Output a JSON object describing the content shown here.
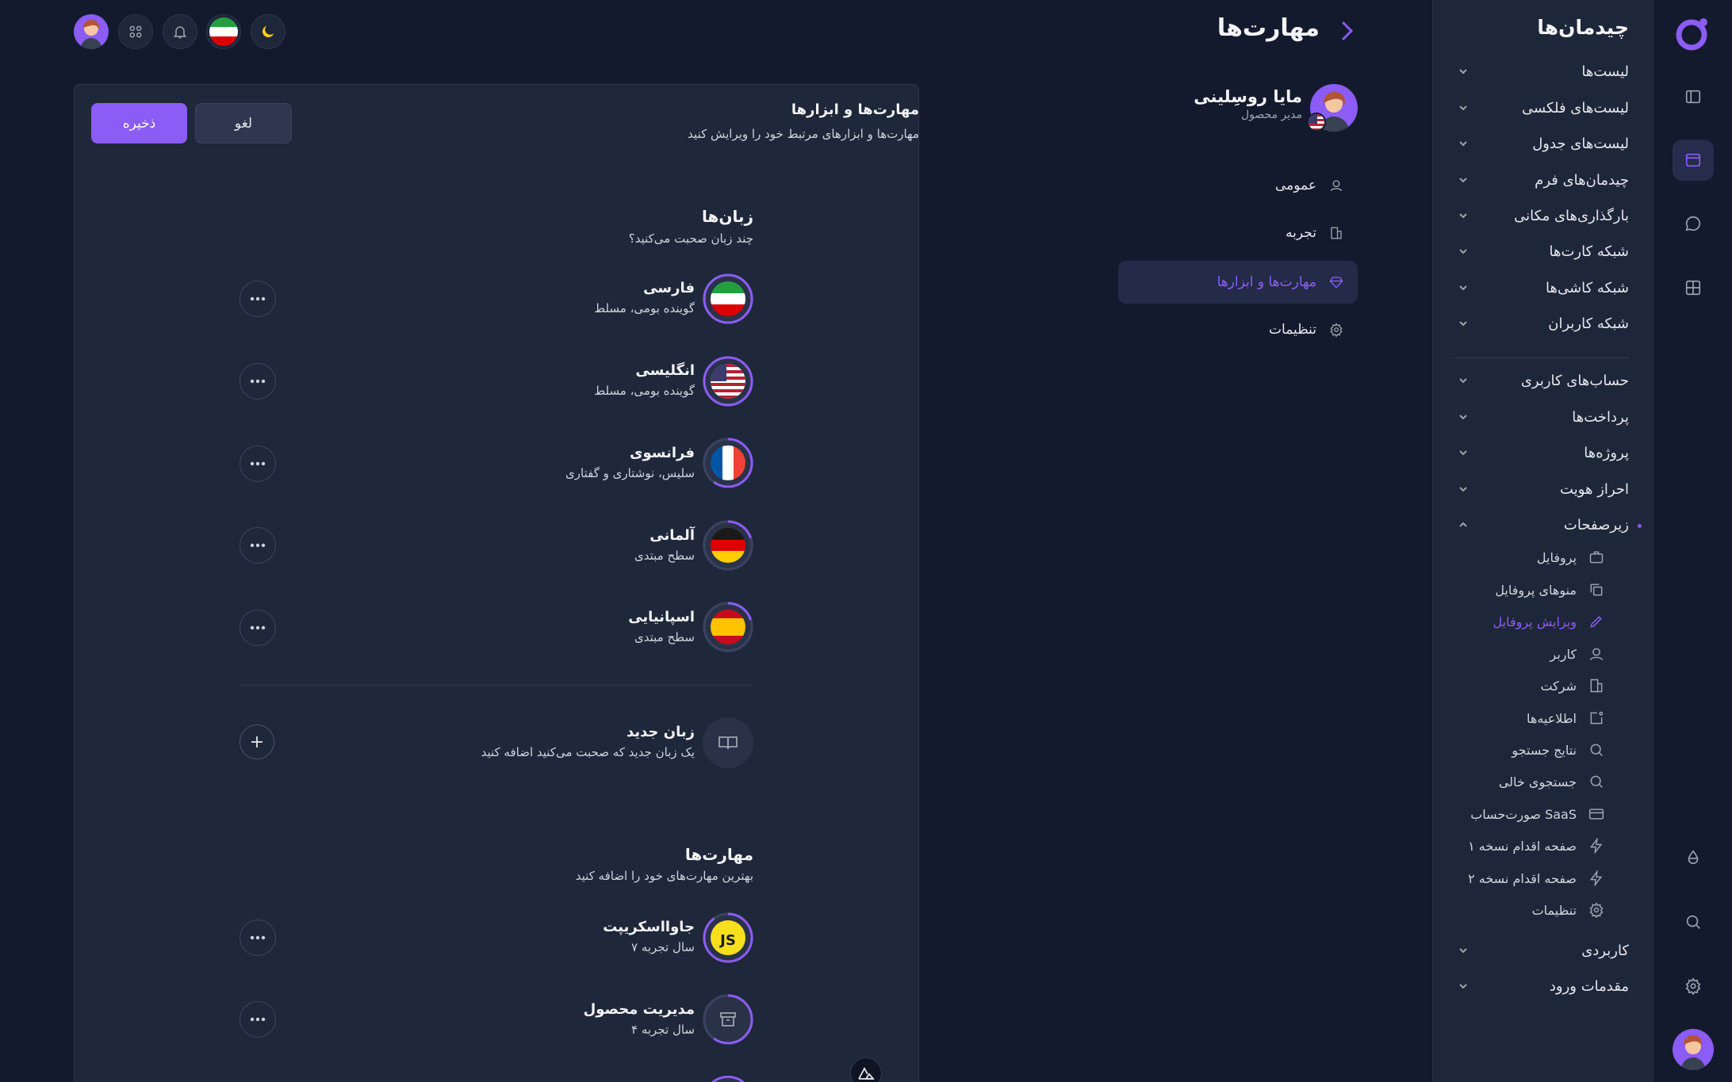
{
  "header": {
    "page_title": "مهارت‌ها"
  },
  "sidebar": {
    "title": "چیدمان‌ها",
    "groups": [
      {
        "label": "لیست‌ها"
      },
      {
        "label": "لیست‌های فلکسی"
      },
      {
        "label": "لیست‌های جدول"
      },
      {
        "label": "چیدمان‌های فرم"
      },
      {
        "label": "بارگذاری‌های مکانی"
      },
      {
        "label": "شبکه کارت‌ها"
      },
      {
        "label": "شبکه کاشی‌ها"
      },
      {
        "label": "شبکه کاربران"
      },
      {
        "label": "حساب‌های کاربری"
      },
      {
        "label": "پرداخت‌ها"
      },
      {
        "label": "پروژه‌ها"
      },
      {
        "label": "احراز هویت"
      },
      {
        "label": "زیرصفحات"
      },
      {
        "label": "کاربردی"
      },
      {
        "label": "مقدمات ورود"
      }
    ],
    "subpages": [
      {
        "label": "پروفایل",
        "icon": "briefcase-icon"
      },
      {
        "label": "منوهای پروفایل",
        "icon": "copy-icon"
      },
      {
        "label": "ویرایش پروفایل",
        "icon": "pencil-icon",
        "active": true
      },
      {
        "label": "کاربر",
        "icon": "user-icon"
      },
      {
        "label": "شرکت",
        "icon": "building-icon"
      },
      {
        "label": "اطلاعیه‌ها",
        "icon": "notification-icon"
      },
      {
        "label": "نتایج جستجو",
        "icon": "search-icon"
      },
      {
        "label": "جستجوی خالی",
        "icon": "search-icon"
      },
      {
        "label": "صورت‌حساب SaaS",
        "icon": "credit-card-icon"
      },
      {
        "label": "صفحه اقدام نسخه ۱",
        "icon": "bolt-icon"
      },
      {
        "label": "صفحه اقدام نسخه ۲",
        "icon": "bolt-icon"
      },
      {
        "label": "تنظیمات",
        "icon": "gear-icon"
      }
    ]
  },
  "profile": {
    "name": "مایا روسِلینی",
    "role": "مدیر محصول"
  },
  "profile_nav": [
    {
      "label": "عمومی",
      "icon": "user-icon"
    },
    {
      "label": "تجربه",
      "icon": "building-icon"
    },
    {
      "label": "مهارت‌ها و ابزارها",
      "icon": "diamond-icon",
      "active": true
    },
    {
      "label": "تنظیمات",
      "icon": "gear-icon"
    }
  ],
  "card": {
    "title": "مهارت‌ها و ابزارها",
    "subtitle": "مهارت‌ها و ابزارهای مرتبط خود را ویرایش کنید",
    "save_label": "ذخیره",
    "cancel_label": "لغو"
  },
  "languages": {
    "title": "زبان‌ها",
    "subtitle": "چند زبان صحبت می‌کنید؟",
    "items": [
      {
        "name": "فارسی",
        "level": "گوینده بومی، مسلط",
        "progress": 1.0,
        "flag": "iran-flag-icon"
      },
      {
        "name": "انگلیسی",
        "level": "گوینده بومی، مسلط",
        "progress": 1.0,
        "flag": "us-flag-icon"
      },
      {
        "name": "فرانسوی",
        "level": "سلیس، نوشتاری و گفتاری",
        "progress": 0.6,
        "flag": "france-flag-icon"
      },
      {
        "name": "آلمانی",
        "level": "سطح مبتدی",
        "progress": 0.2,
        "flag": "germany-flag-icon"
      },
      {
        "name": "اسپانیایی",
        "level": "سطح مبتدی",
        "progress": 0.2,
        "flag": "spain-flag-icon"
      }
    ],
    "new": {
      "title": "زبان جدید",
      "subtitle": "یک زبان جدید که صحبت می‌کنید اضافه کنید"
    }
  },
  "skills": {
    "title": "مهارت‌ها",
    "subtitle": "بهترین مهارت‌های خود را اضافه کنید",
    "items": [
      {
        "name": "جاوااسکریپت",
        "experience": "۷ سال تجربه",
        "progress": 0.9,
        "icon": "js-icon"
      },
      {
        "name": "مدیریت محصول",
        "experience": "۴ سال تجربه",
        "progress": 0.6,
        "icon": "archive-icon"
      }
    ]
  },
  "colors": {
    "accent": "#8b5cf6",
    "background": "#141a2e",
    "card": "#1f273a"
  }
}
